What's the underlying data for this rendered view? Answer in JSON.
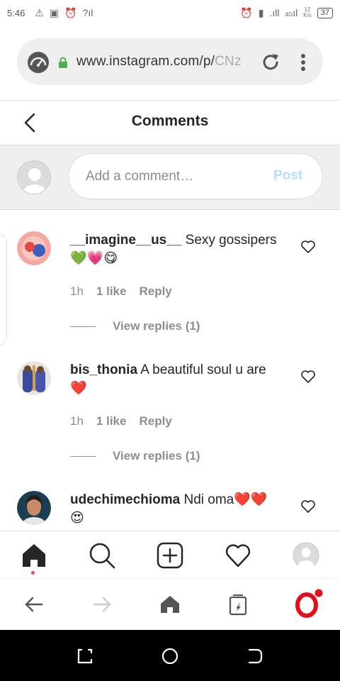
{
  "status_bar": {
    "time": "5:46",
    "network_type": "4G",
    "net_speed_value": "12",
    "net_speed_unit": "K/s",
    "battery": "37"
  },
  "browser": {
    "url_main": "www.instagram.com/p/",
    "url_faded": "CNz",
    "icons": [
      "speed-dial-icon",
      "lock-icon",
      "reload-icon",
      "more-vert-icon"
    ]
  },
  "header": {
    "title": "Comments"
  },
  "add_comment": {
    "placeholder": "Add a comment…",
    "post_label": "Post"
  },
  "comments": [
    {
      "username": "__imagine__us__",
      "text": " Sexy gossipers",
      "emoji": "💚💗😋",
      "time": "1h",
      "likes": "1 like",
      "reply_label": "Reply",
      "view_replies": "View replies (1)"
    },
    {
      "username": "bis_thonia",
      "text": " A beautiful soul u are",
      "emoji": "❤️",
      "time": "1h",
      "likes": "1 like",
      "reply_label": "Reply",
      "view_replies": "View replies (1)"
    },
    {
      "username": "udechimechioma",
      "text": " Ndi oma❤️❤️",
      "emoji": "😍"
    }
  ],
  "bottom_nav": [
    "home-icon",
    "search-icon",
    "new-post-icon",
    "activity-heart-icon",
    "profile-icon"
  ],
  "browser_nav": [
    "back-arrow-icon",
    "forward-arrow-icon",
    "browser-home-icon",
    "tabs-icon",
    "opera-logo-icon"
  ],
  "colors": {
    "link_blue_disabled": "#b2dffc",
    "secondary_text": "#8e8e8e",
    "notification_red": "#ed4956",
    "opera_red": "#e3101c"
  }
}
